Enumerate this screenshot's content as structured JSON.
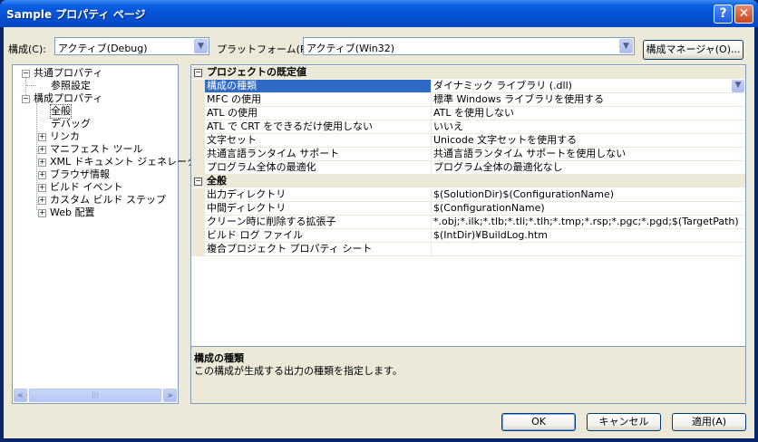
{
  "window": {
    "title": "Sample プロパティ ページ",
    "help_glyph": "?",
    "close_glyph": "✕"
  },
  "config": {
    "label": "構成(C):",
    "value": "アクティブ(Debug)",
    "platform_label": "プラットフォーム(P):",
    "platform_value": "アクティブ(Win32)",
    "manager_button": "構成マネージャ(O)..."
  },
  "tree": {
    "items": [
      {
        "label": "共通プロパティ",
        "expander": "−"
      },
      {
        "label": "参照設定"
      },
      {
        "label": "構成プロパティ",
        "expander": "−"
      },
      {
        "label": "全般"
      },
      {
        "label": "デバッグ"
      },
      {
        "label": "リンカ",
        "expander": "+"
      },
      {
        "label": "マニフェスト ツール",
        "expander": "+"
      },
      {
        "label": "XML ドキュメント ジェネレータ",
        "expander": "+"
      },
      {
        "label": "ブラウザ情報",
        "expander": "+"
      },
      {
        "label": "ビルド イベント",
        "expander": "+"
      },
      {
        "label": "カスタム ビルド ステップ",
        "expander": "+"
      },
      {
        "label": "Web 配置",
        "expander": "+"
      }
    ],
    "scroll_left": "<",
    "scroll_right": ">",
    "thumb_grip": "|||"
  },
  "grid": {
    "categories": [
      {
        "title": "プロジェクトの既定値",
        "expander": "−",
        "rows": [
          {
            "name": "構成の種類",
            "value": "ダイナミック ライブラリ (.dll)"
          },
          {
            "name": "MFC の使用",
            "value": "標準 Windows ライブラリを使用する"
          },
          {
            "name": "ATL の使用",
            "value": "ATL を使用しない"
          },
          {
            "name": "ATL で CRT をできるだけ使用しない",
            "value": "いいえ"
          },
          {
            "name": "文字セット",
            "value": "Unicode 文字セットを使用する"
          },
          {
            "name": "共通言語ランタイム サポート",
            "value": "共通言語ランタイム サポートを使用しない"
          },
          {
            "name": "プログラム全体の最適化",
            "value": "プログラム全体の最適化なし"
          }
        ]
      },
      {
        "title": "全般",
        "expander": "−",
        "rows": [
          {
            "name": "出力ディレクトリ",
            "value": "$(SolutionDir)$(ConfigurationName)"
          },
          {
            "name": "中間ディレクトリ",
            "value": "$(ConfigurationName)"
          },
          {
            "name": "クリーン時に削除する拡張子",
            "value": "*.obj;*.ilk;*.tlb;*.tli;*.tlh;*.tmp;*.rsp;*.pgc;*.pgd;$(TargetPath)"
          },
          {
            "name": "ビルド ログ ファイル",
            "value": "$(IntDir)¥BuildLog.htm"
          },
          {
            "name": "複合プロジェクト プロパティ シート",
            "value": ""
          }
        ]
      }
    ]
  },
  "description": {
    "title": "構成の種類",
    "text": "この構成が生成する出力の種類を指定します。"
  },
  "buttons": {
    "ok": "OK",
    "cancel": "キャンセル",
    "apply": "適用(A)"
  },
  "icons": {
    "dropdown": "▼"
  }
}
